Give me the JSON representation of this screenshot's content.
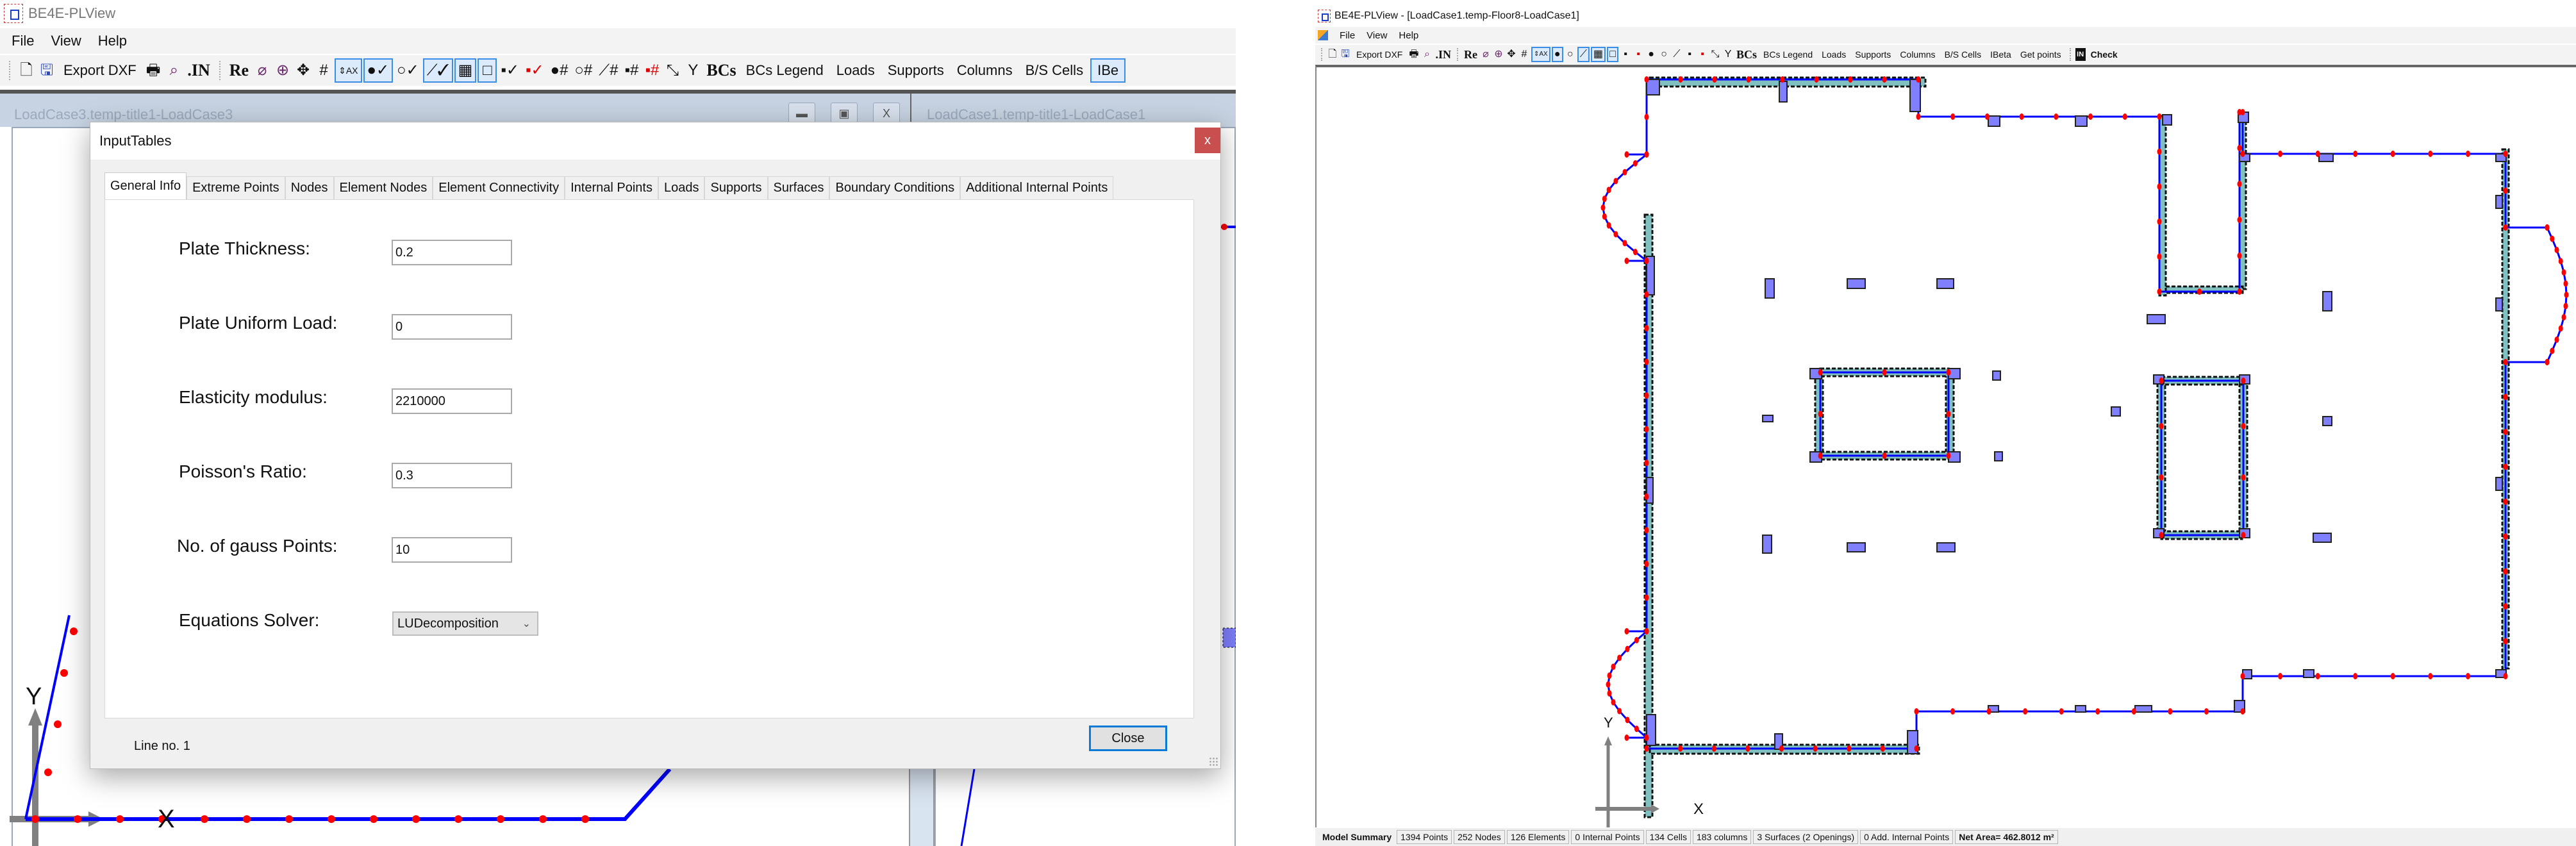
{
  "left_window": {
    "title": "BE4E-PLView",
    "menu": [
      "File",
      "View",
      "Help"
    ],
    "toolbar": {
      "export_dxf": "Export DXF",
      "in_label": ".IN",
      "re_label": "Re",
      "bcs_label": "BCs",
      "text_buttons": [
        "BCs Legend",
        "Loads",
        "Supports",
        "Columns",
        "B/S Cells",
        "IBe"
      ]
    },
    "mdi_children": [
      {
        "title": "LoadCase3.temp-title1-LoadCase3"
      },
      {
        "title": "LoadCase1.temp-title1-LoadCase1"
      }
    ],
    "mdi_buttons": {
      "minimize": "▬",
      "restore": "▣",
      "close": "X"
    },
    "axis": {
      "x_label": "X",
      "y_label": "Y"
    }
  },
  "dialog": {
    "title": "InputTables",
    "close_x": "x",
    "tabs": [
      {
        "label": "General Info",
        "active": true
      },
      {
        "label": "Extreme Points",
        "active": false
      },
      {
        "label": "Nodes",
        "active": false
      },
      {
        "label": "Element Nodes",
        "active": false
      },
      {
        "label": "Element Connectivity",
        "active": false
      },
      {
        "label": "Internal Points",
        "active": false
      },
      {
        "label": "Loads",
        "active": false
      },
      {
        "label": "Supports",
        "active": false
      },
      {
        "label": "Surfaces",
        "active": false
      },
      {
        "label": "Boundary Conditions",
        "active": false
      },
      {
        "label": "Additional Internal Points",
        "active": false
      }
    ],
    "fields": [
      {
        "label": "Plate Thickness:",
        "value": "0.2"
      },
      {
        "label": "Plate Uniform Load:",
        "value": "0"
      },
      {
        "label": "Elasticity modulus:",
        "value": "2210000"
      },
      {
        "label": "Poisson's Ratio:",
        "value": "0.3"
      },
      {
        "label": "No. of gauss Points:",
        "value": "10"
      }
    ],
    "solver": {
      "label": "Equations Solver:",
      "selected": "LUDecomposition"
    },
    "status": "Line no. 1",
    "close_button": "Close"
  },
  "right_window": {
    "title": "BE4E-PLView - [LoadCase1.temp-Floor8-LoadCase1]",
    "menu": [
      "File",
      "View",
      "Help"
    ],
    "toolbar": {
      "export_dxf": "Export DXF",
      "in_label": ".IN",
      "re_label": "Re",
      "bcs_label": "BCs",
      "text_buttons": [
        "BCs Legend",
        "Loads",
        "Supports",
        "Columns",
        "B/S Cells",
        "IBeta",
        "Get points"
      ],
      "in_icon_label": "IN",
      "check_label": "Check"
    },
    "axis": {
      "x_label": "X",
      "y_label": "Y"
    },
    "status_bar": {
      "title": "Model Summary",
      "cells": [
        "1394 Points",
        "252 Nodes",
        "126 Elements",
        "0 Internal Points",
        "134 Cells",
        "183 columns",
        "3 Surfaces (2 Openings)",
        "0 Add. Internal Points"
      ],
      "net_area": "Net Area= 462.8012 m²"
    }
  },
  "colors": {
    "boundary_line": "#0000ff",
    "node_point": "#ff0000",
    "column_fill": "#8080ff",
    "cell_fill": "#80c0c0",
    "dialog_close": "#c94f4f",
    "focus_border": "#0a7ad6",
    "axis_gray": "#808080"
  }
}
